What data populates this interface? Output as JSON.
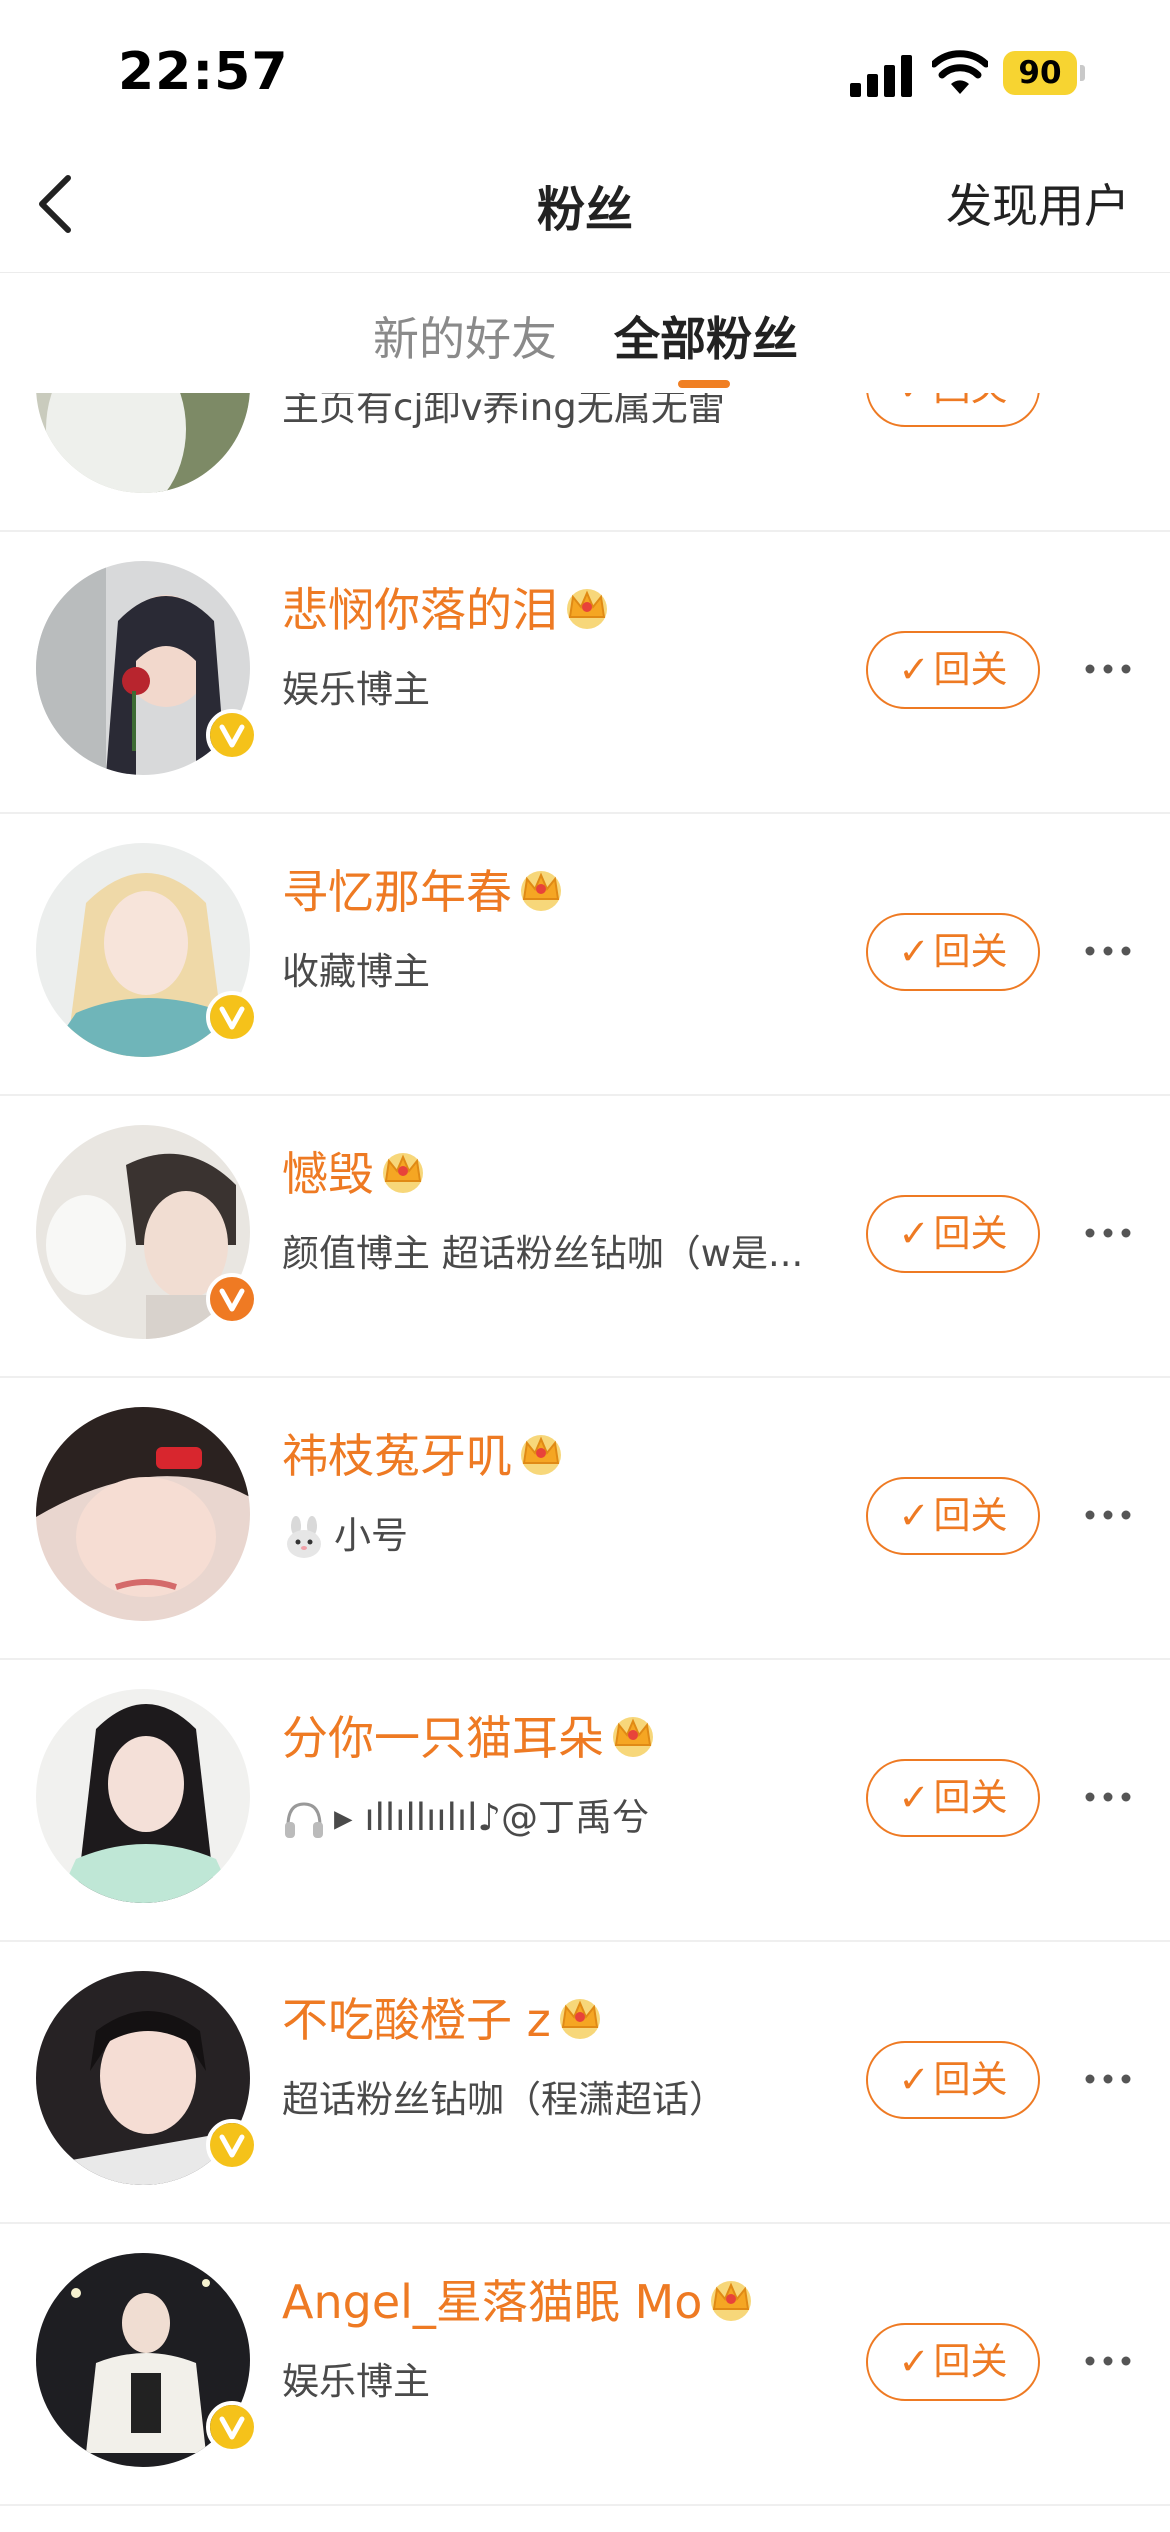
{
  "status_bar": {
    "time": "22:57",
    "battery": "90"
  },
  "nav": {
    "title": "粉丝",
    "right_action": "发现用户"
  },
  "tabs": [
    {
      "label": "新的好友",
      "active": false
    },
    {
      "label": "全部粉丝",
      "active": true
    }
  ],
  "follow_label": "回关",
  "partial_row": {
    "desc": "主页有cj卸v养ing无属无雷"
  },
  "fans": [
    {
      "name": "悲悯你落的泪",
      "desc": "娱乐博主",
      "badge": "yellow",
      "crown": "crown-icon"
    },
    {
      "name": "寻忆那年春",
      "desc": "收藏博主",
      "badge": "yellow",
      "crown": "crown-icon"
    },
    {
      "name": "憾毁",
      "desc": "颜值博主 超话粉丝钻咖（w是...",
      "badge": "orange",
      "crown": "crown-icon"
    },
    {
      "name": "祎枝菟牙叽",
      "desc": "小号",
      "desc_icon": "rabbit-icon",
      "badge": "none",
      "crown": "crown-icon"
    },
    {
      "name": "分你一只猫耳朵",
      "desc": "▸ ıllıllıılıl♪@丁禹兮",
      "desc_icon": "headphones-icon",
      "badge": "none",
      "crown": "crown-icon"
    },
    {
      "name": "不吃酸橙子 z",
      "desc": "超话粉丝钻咖（程潇超话）",
      "badge": "yellow",
      "crown": "crown-icon"
    },
    {
      "name": "Angel_星落猫眠 Mo",
      "desc": "娱乐博主",
      "badge": "yellow",
      "crown": "crown-icon"
    }
  ],
  "colors": {
    "accent": "#ee7a23",
    "badge_yellow": "#f5c21a",
    "badge_orange": "#ef7a23"
  }
}
